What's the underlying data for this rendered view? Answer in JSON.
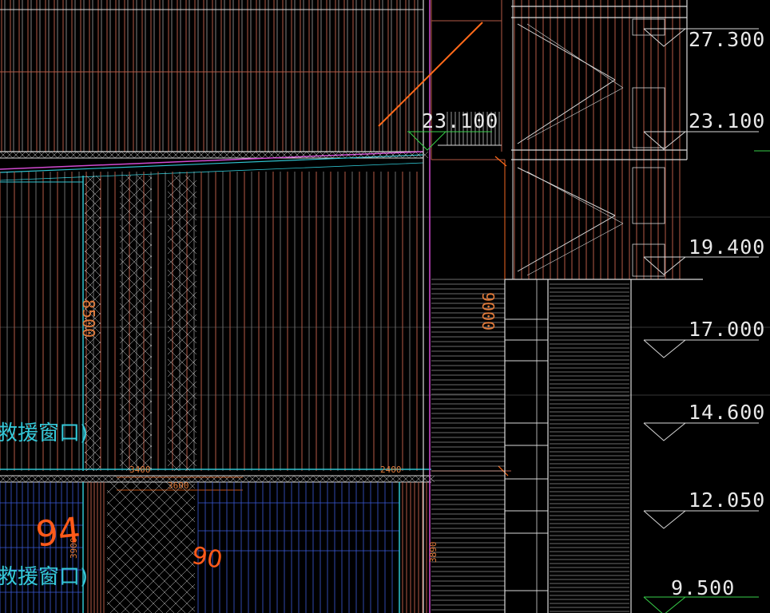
{
  "drawing": {
    "background": "#000000",
    "colors": {
      "wall": "#b45a46",
      "column": "#c66a50",
      "white": "#d9d9d9",
      "cyan": "#2fc4d0",
      "blue": "#3b5bd8",
      "magenta": "#d24ad2",
      "orange": "#ff6a1a",
      "green": "#38d04a",
      "grid": "#6f6f6f"
    },
    "elevations": {
      "el_27300": "27.300",
      "el_23100_right": "23.100",
      "el_23100_mid": "23.100",
      "el_19400": "19.400",
      "el_17000": "17.000",
      "el_14600": "14.600",
      "el_12050": "12.050",
      "el_9500": "9.500"
    },
    "dimensions": {
      "d_8500": "8500",
      "d_9000": "9000",
      "d_3900_left": "3900",
      "d_3890": "3890",
      "d_3400": "3400",
      "d_3600": "3600",
      "d_2400": "2400"
    },
    "labels": {
      "rescue_window_top": "救援窗口)",
      "rescue_window_bottom": "救援窗口)"
    },
    "handwritten": {
      "mark_94": "94",
      "mark_90": "90"
    }
  }
}
